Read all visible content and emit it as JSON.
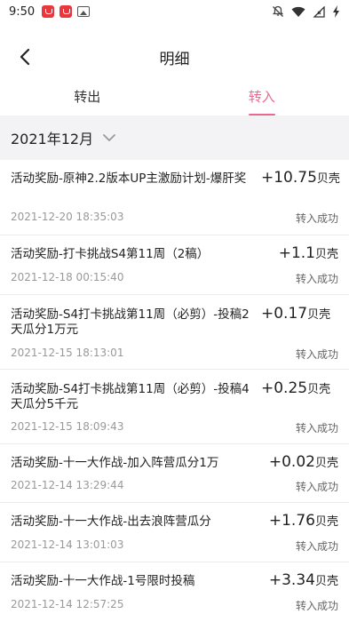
{
  "status_bar": {
    "time": "9:50"
  },
  "header": {
    "title": "明细"
  },
  "tabs": [
    {
      "label": "转出",
      "active": false
    },
    {
      "label": "转入",
      "active": true
    }
  ],
  "filter": {
    "month": "2021年12月"
  },
  "colors": {
    "accent": "#e96a8e",
    "muted": "#999999",
    "divider": "#ececec",
    "band": "#f3f3f5"
  },
  "records": [
    {
      "title": "活动奖励-原神2.2版本UP主激励计划-爆肝奖",
      "amount": "+10.75",
      "unit": "贝壳",
      "date": "2021-12-20 18:35:03",
      "status": "转入成功"
    },
    {
      "title": "活动奖励-打卡挑战S4第11周（2稿）",
      "amount": "+1.1",
      "unit": "贝壳",
      "date": "2021-12-18 00:15:40",
      "status": "转入成功"
    },
    {
      "title": "活动奖励-S4打卡挑战第11周（必剪）-投稿2天瓜分1万元",
      "amount": "+0.17",
      "unit": "贝壳",
      "date": "2021-12-15 18:13:01",
      "status": "转入成功"
    },
    {
      "title": "活动奖励-S4打卡挑战第11周（必剪）-投稿4天瓜分5千元",
      "amount": "+0.25",
      "unit": "贝壳",
      "date": "2021-12-15 18:09:43",
      "status": "转入成功"
    },
    {
      "title": "活动奖励-十一大作战-加入阵营瓜分1万",
      "amount": "+0.02",
      "unit": "贝壳",
      "date": "2021-12-14 13:29:44",
      "status": "转入成功"
    },
    {
      "title": "活动奖励-十一大作战-出去浪阵营瓜分",
      "amount": "+1.76",
      "unit": "贝壳",
      "date": "2021-12-14 13:01:03",
      "status": "转入成功"
    },
    {
      "title": "活动奖励-十一大作战-1号限时投稿",
      "amount": "+3.34",
      "unit": "贝壳",
      "date": "2021-12-14 12:57:25",
      "status": "转入成功"
    }
  ]
}
